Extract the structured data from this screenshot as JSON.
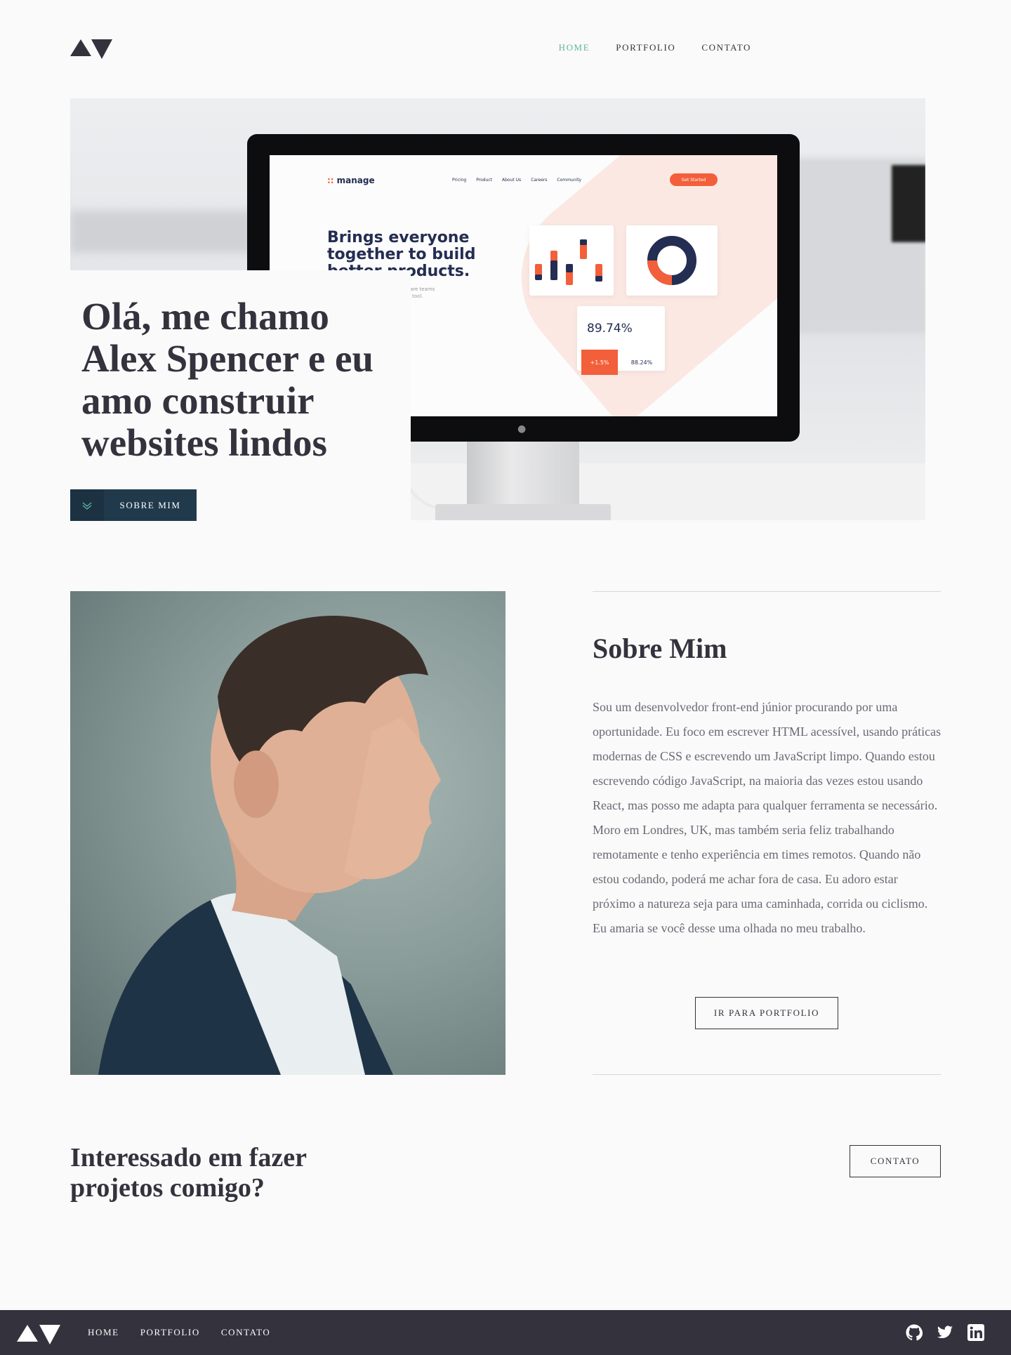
{
  "header": {
    "nav": [
      {
        "label": "HOME",
        "active": true
      },
      {
        "label": "PORTFOLIO",
        "active": false
      },
      {
        "label": "CONTATO",
        "active": false
      }
    ]
  },
  "hero": {
    "title": "Olá, me chamo Alex Spencer e eu amo construir websites lindos",
    "button_label": "SOBRE MIM",
    "button_icon": "chevrons-down-icon",
    "mockup": {
      "brand": "manage",
      "nav": [
        "Pricing",
        "Product",
        "About Us",
        "Careers",
        "Community"
      ],
      "cta": "Get Started",
      "headline": "Brings everyone together to build better products.",
      "subtext": "Manage makes it simple for software teams to plan day-to-day tasks are not a tool.",
      "percent": "89.74%",
      "chip_a": "+1.5%",
      "chip_b": "88.24%"
    }
  },
  "about": {
    "title": "Sobre Mim",
    "text": "Sou um desenvolvedor front-end júnior procurando por uma oportunidade. Eu foco em escrever HTML acessível, usando práticas modernas de CSS e escrevendo um JavaScript limpo. Quando estou escrevendo código JavaScript, na maioria das vezes estou usando React, mas posso me adapta para qualquer ferramenta se necessário. Moro em Londres, UK, mas também seria feliz trabalhando remotamente e tenho experiência em times remotos. Quando não estou codando, poderá me achar fora de casa. Eu adoro estar próximo a natureza seja para uma caminhada, corrida ou ciclismo. Eu amaria se você desse uma olhada no meu trabalho.",
    "button_label": "IR PARA PORTFOLIO"
  },
  "cta": {
    "title": "Interessado em fazer projetos comigo?",
    "button_label": "CONTATO"
  },
  "footer": {
    "nav": [
      "HOME",
      "PORTFOLIO",
      "CONTATO"
    ],
    "social": [
      "github-icon",
      "twitter-icon",
      "linkedin-icon"
    ]
  },
  "colors": {
    "background": "#fafafa",
    "text_dark": "#33323d",
    "accent_green": "#5fb4a2",
    "button_dark": "#203a4c",
    "footer": "#33323d"
  }
}
